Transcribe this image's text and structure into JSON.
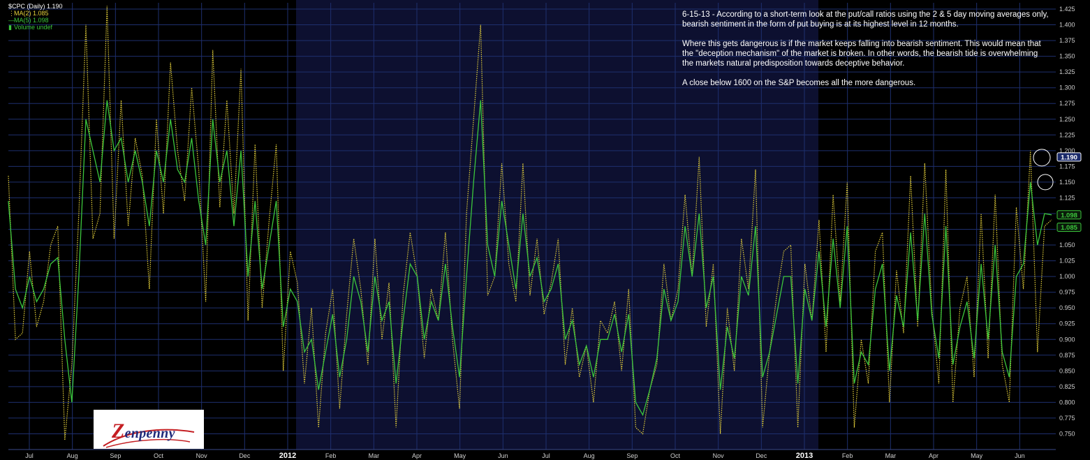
{
  "legend": {
    "title": "$CPC (Daily) 1.190",
    "ma2": "MA(2) 1.085",
    "ma5": "MA(5) 1.098",
    "volume": "Volume undef"
  },
  "annotation": {
    "p1": "6-15-13 - According to a short-term look at the put/call ratios using the 2 & 5 day moving averages only, bearish sentiment in the form of put buying is at its highest level in 12 months.",
    "p2": "Where this gets dangerous is if the market keeps falling into bearish sentiment. This would mean that the \"deception mechanism\" of the market is broken. In other words, the bearish tide is overwhelming the markets natural predisposition towards deceptive behavior.",
    "p3": "A close below 1600 on the S&P becomes all the more dangerous."
  },
  "logo": {
    "text": "enpenny",
    "initial": "Z"
  },
  "colors": {
    "background": "#000000",
    "shaded_region": "#0d1030",
    "grid": "#1e2f6e",
    "ma2": "#e6d23a",
    "ma5": "#3cc63c",
    "axis_text": "#cfcfcf",
    "label_text": "#ffffff"
  },
  "chart_data": {
    "type": "line",
    "ylim": [
      0.725,
      1.435
    ],
    "yticks": [
      "0.750",
      "0.775",
      "0.800",
      "0.825",
      "0.850",
      "0.875",
      "0.900",
      "0.925",
      "0.950",
      "0.975",
      "1.000",
      "1.025",
      "1.050",
      "1.075",
      "1.100",
      "1.125",
      "1.150",
      "1.175",
      "1.200",
      "1.225",
      "1.250",
      "1.275",
      "1.300",
      "1.325",
      "1.350",
      "1.375",
      "1.400",
      "1.425"
    ],
    "x_labels": [
      "Jul",
      "Aug",
      "Sep",
      "Oct",
      "Nov",
      "Dec",
      "2012",
      "Feb",
      "Mar",
      "Apr",
      "May",
      "Jun",
      "Jul",
      "Aug",
      "Sep",
      "Oct",
      "Nov",
      "Dec",
      "2013",
      "Feb",
      "Mar",
      "Apr",
      "May",
      "Jun"
    ],
    "price_labels": [
      {
        "text": "1.190",
        "value": 1.19,
        "circled": true
      },
      {
        "text": "1.098",
        "value": 1.098,
        "circled": false
      },
      {
        "text": "1.085",
        "value": 1.085,
        "circled": false
      }
    ],
    "shaded_range_months": [
      "2012",
      "Dec 2012"
    ],
    "series": [
      {
        "name": "MA(2)",
        "style": "dotted",
        "values": [
          1.16,
          0.9,
          0.91,
          1.04,
          0.92,
          0.96,
          1.05,
          1.08,
          0.74,
          0.86,
          1.1,
          1.4,
          1.06,
          1.1,
          1.43,
          1.06,
          1.28,
          1.08,
          1.22,
          1.16,
          0.98,
          1.25,
          1.1,
          1.34,
          1.2,
          1.12,
          1.3,
          1.17,
          0.96,
          1.36,
          1.11,
          1.28,
          1.1,
          1.33,
          0.93,
          1.21,
          0.95,
          1.09,
          1.21,
          0.85,
          1.04,
          0.99,
          0.83,
          0.95,
          0.76,
          0.91,
          0.98,
          0.79,
          0.94,
          1.06,
          0.98,
          0.86,
          1.06,
          0.9,
          0.99,
          0.76,
          0.97,
          1.07,
          1.0,
          0.87,
          0.98,
          0.93,
          1.07,
          0.9,
          0.79,
          1.1,
          1.25,
          1.4,
          0.97,
          1.0,
          1.18,
          1.02,
          0.96,
          1.18,
          0.97,
          1.06,
          0.94,
          0.99,
          1.06,
          0.86,
          0.95,
          0.84,
          0.89,
          0.8,
          0.93,
          0.91,
          0.96,
          0.85,
          0.98,
          0.76,
          0.75,
          0.82,
          0.86,
          1.02,
          0.93,
          0.98,
          1.13,
          1.0,
          1.19,
          0.92,
          1.02,
          0.75,
          0.95,
          0.85,
          1.06,
          0.98,
          1.17,
          0.76,
          0.88,
          0.97,
          1.04,
          1.05,
          0.76,
          1.02,
          0.93,
          1.09,
          0.88,
          1.13,
          0.96,
          1.15,
          0.76,
          0.9,
          0.83,
          1.04,
          1.07,
          0.8,
          1.01,
          0.91,
          1.16,
          0.92,
          1.18,
          0.95,
          0.83,
          1.17,
          0.8,
          0.95,
          1.0,
          0.84,
          1.1,
          0.87,
          1.13,
          0.86,
          0.8,
          1.11,
          0.98,
          1.2,
          0.88,
          1.08,
          1.09
        ]
      },
      {
        "name": "MA(5)",
        "style": "solid",
        "values": [
          1.12,
          0.98,
          0.95,
          1.0,
          0.96,
          0.98,
          1.02,
          1.03,
          0.9,
          0.8,
          1.0,
          1.25,
          1.2,
          1.15,
          1.28,
          1.2,
          1.22,
          1.15,
          1.2,
          1.15,
          1.08,
          1.2,
          1.15,
          1.25,
          1.17,
          1.15,
          1.22,
          1.12,
          1.05,
          1.25,
          1.15,
          1.2,
          1.08,
          1.2,
          1.0,
          1.12,
          0.98,
          1.05,
          1.12,
          0.92,
          0.98,
          0.96,
          0.88,
          0.9,
          0.82,
          0.88,
          0.94,
          0.84,
          0.9,
          1.0,
          0.96,
          0.88,
          1.0,
          0.93,
          0.96,
          0.83,
          0.93,
          1.02,
          1.0,
          0.9,
          0.96,
          0.93,
          1.02,
          0.92,
          0.84,
          1.0,
          1.15,
          1.28,
          1.05,
          1.0,
          1.12,
          1.05,
          0.98,
          1.1,
          1.0,
          1.03,
          0.96,
          0.98,
          1.02,
          0.9,
          0.93,
          0.86,
          0.89,
          0.84,
          0.9,
          0.9,
          0.94,
          0.88,
          0.94,
          0.8,
          0.78,
          0.82,
          0.87,
          0.98,
          0.93,
          0.96,
          1.08,
          1.0,
          1.1,
          0.95,
          1.0,
          0.82,
          0.92,
          0.87,
          1.0,
          0.97,
          1.08,
          0.84,
          0.88,
          0.94,
          1.0,
          1.0,
          0.83,
          0.98,
          0.93,
          1.04,
          0.92,
          1.06,
          0.95,
          1.08,
          0.83,
          0.88,
          0.86,
          0.98,
          1.02,
          0.85,
          0.97,
          0.92,
          1.07,
          0.93,
          1.1,
          0.94,
          0.87,
          1.08,
          0.86,
          0.92,
          0.96,
          0.87,
          1.02,
          0.9,
          1.05,
          0.88,
          0.84,
          1.0,
          1.02,
          1.15,
          1.05,
          1.1,
          1.098
        ]
      }
    ]
  }
}
